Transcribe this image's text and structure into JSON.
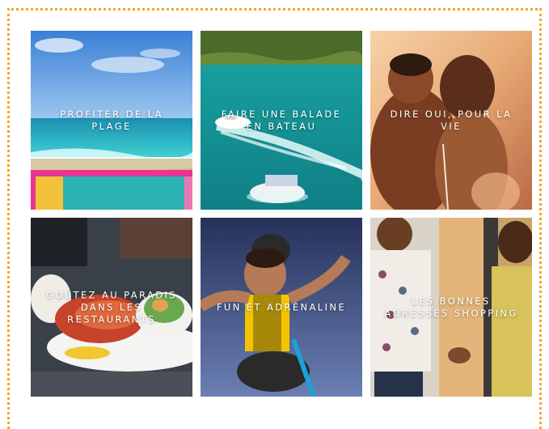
{
  "accent_color": "#f5a623",
  "tiles": [
    {
      "label": "PROFITER DE LA PLAGE",
      "image": "beach-scene"
    },
    {
      "label": "FAIRE UNE BALADE EN BATEAU",
      "image": "speedboat-scene"
    },
    {
      "label": "DIRE OUI, POUR LA VIE",
      "image": "couple-kiss-scene"
    },
    {
      "label": "GOÛTEZ AU PARADIS DANS LES RESTAURANTS",
      "image": "lobster-dish-scene"
    },
    {
      "label": "FUN ET ADRÉNALINE",
      "image": "skydiving-scene"
    },
    {
      "label": "LES BONNES ADRESSES SHOPPING",
      "image": "couple-shopping-scene"
    }
  ]
}
